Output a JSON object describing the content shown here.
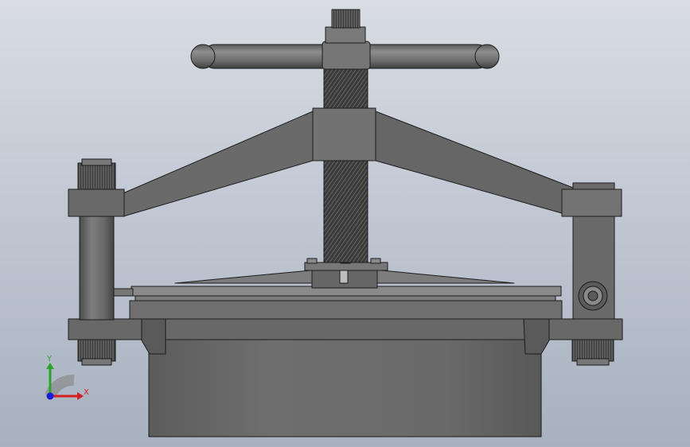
{
  "view": {
    "model_name": "",
    "triad": {
      "x_label": "X",
      "y_label": "Y"
    }
  },
  "colors": {
    "background_top": "#d9dde3",
    "background_bottom": "#a7b1bf",
    "part_fill": "#6a6a6a",
    "part_dark": "#4a4a4a",
    "part_light": "#8a8a8a",
    "edge": "#1c1c1c",
    "axis_x": "#d42020",
    "axis_y": "#2aa52a",
    "axis_z": "#1a1adb"
  },
  "icons": {
    "triad": "coordinate-triad-icon"
  }
}
